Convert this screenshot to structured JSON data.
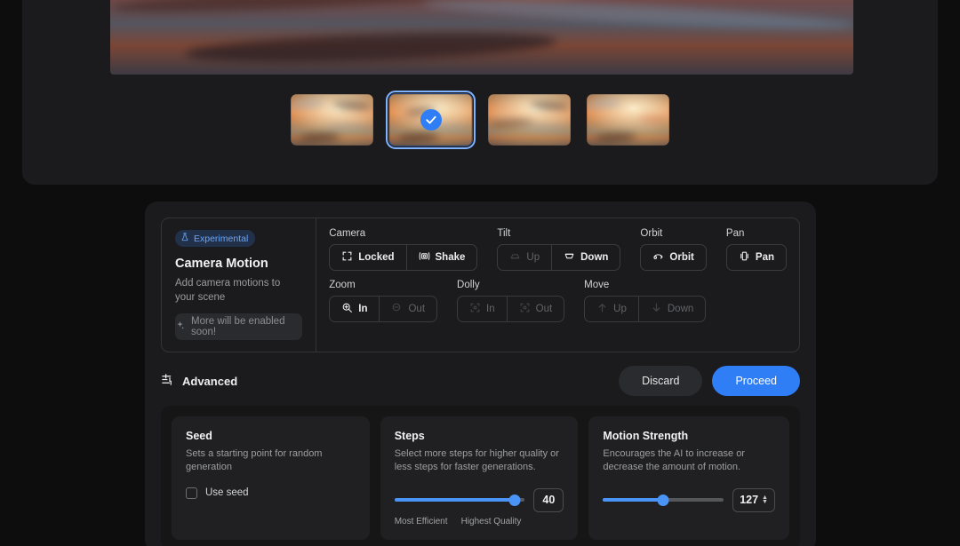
{
  "preview": {
    "hero_alt": "sunset-sky-preview",
    "thumbnails": [
      {
        "name": "thumbnail-1",
        "selected": false
      },
      {
        "name": "thumbnail-2",
        "selected": true
      },
      {
        "name": "thumbnail-3",
        "selected": false
      },
      {
        "name": "thumbnail-4",
        "selected": false
      }
    ],
    "check_icon": "check-circle-icon"
  },
  "camera_motion": {
    "badge": {
      "label": "Experimental",
      "icon": "flask-icon"
    },
    "title": "Camera Motion",
    "subtitle": "Add camera motions to your scene",
    "soon_button": {
      "label": "More will be enabled soon!",
      "icon": "sparkle-icon"
    },
    "groups": [
      {
        "label": "Camera",
        "options": [
          {
            "label": "Locked",
            "icon": "frame-corners-icon",
            "active": true
          },
          {
            "label": "Shake",
            "icon": "camera-shake-icon",
            "active": true
          }
        ]
      },
      {
        "label": "Tilt",
        "options": [
          {
            "label": "Up",
            "icon": "tilt-up-icon",
            "active": false
          },
          {
            "label": "Down",
            "icon": "tilt-down-icon",
            "active": true
          }
        ]
      },
      {
        "label": "Orbit",
        "options": [
          {
            "label": "Orbit",
            "icon": "orbit-icon",
            "active": true
          }
        ]
      },
      {
        "label": "Pan",
        "options": [
          {
            "label": "Pan",
            "icon": "pan-icon",
            "active": true
          }
        ]
      },
      {
        "label": "Zoom",
        "options": [
          {
            "label": "In",
            "icon": "zoom-in-icon",
            "active": true
          },
          {
            "label": "Out",
            "icon": "zoom-out-icon",
            "active": false
          }
        ]
      },
      {
        "label": "Dolly",
        "options": [
          {
            "label": "In",
            "icon": "dolly-in-icon",
            "active": false
          },
          {
            "label": "Out",
            "icon": "dolly-out-icon",
            "active": false
          }
        ]
      },
      {
        "label": "Move",
        "options": [
          {
            "label": "Up",
            "icon": "arrow-up-icon",
            "active": false
          },
          {
            "label": "Down",
            "icon": "arrow-down-icon",
            "active": false
          }
        ]
      }
    ]
  },
  "advanced_row": {
    "label": "Advanced",
    "icon": "sliders-icon",
    "discard_label": "Discard",
    "proceed_label": "Proceed"
  },
  "advanced_settings": {
    "seed": {
      "title": "Seed",
      "description": "Sets a starting point for random generation",
      "checkbox_label": "Use seed",
      "checked": false
    },
    "steps": {
      "title": "Steps",
      "description": "Select more steps for higher quality or less steps for faster generations.",
      "value": "40",
      "percent": 92,
      "scale_min_label": "Most Efficient",
      "scale_max_label": "Highest Quality"
    },
    "motion_strength": {
      "title": "Motion Strength",
      "description": "Encourages the AI to increase or decrease the amount of motion.",
      "value": "127",
      "percent": 50,
      "stepper_up": "▲",
      "stepper_down": "▼"
    }
  },
  "colors": {
    "accent": "#2f7ef6",
    "slider": "#4a93f7",
    "panel": "#1b1b1d",
    "card": "#202022",
    "background": "#0d0d0e",
    "badge_text": "#6ba4f8"
  }
}
